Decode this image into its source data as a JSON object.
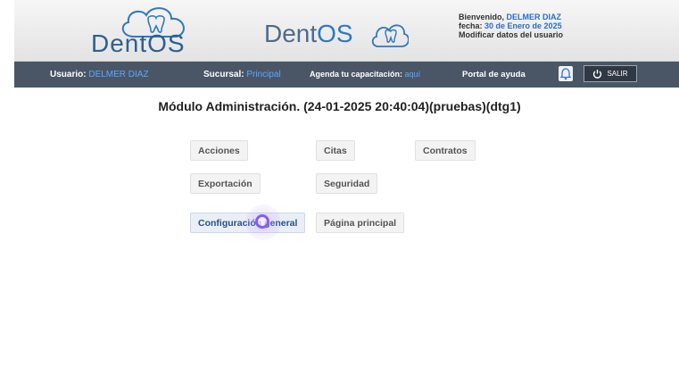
{
  "header": {
    "logo_text": "DentOS",
    "logo_center_part1": "Dent",
    "logo_center_part2": "OS",
    "welcome_prefix": "Bienvenido,",
    "welcome_user": "DELMER DIAZ",
    "date_prefix": "fecha:",
    "date_value": "30 de Enero de 2025",
    "modify_link": "Modificar datos del usuario"
  },
  "navbar": {
    "user_label": "Usuario:",
    "user_value": "DELMER DIAZ",
    "branch_label": "Sucursal:",
    "branch_value": "Principal",
    "training_label": "Agenda tu capacitación:",
    "training_link": "aquí",
    "help_label": "Portal de ayuda",
    "logout_label": "SALIR"
  },
  "main": {
    "title": "Módulo Administración. (24-01-2025 20:40:04)(pruebas)(dtg1)",
    "buttons": [
      "Acciones",
      "Citas",
      "Contratos",
      "Exportación",
      "Seguridad",
      "Configuración general",
      "Página principal"
    ]
  },
  "icons": {
    "bell": "bell-icon",
    "power": "power-icon",
    "tooth": "tooth-cloud-icon"
  },
  "colors": {
    "navbar": "#4a5666",
    "accent": "#2a6fc9",
    "link": "#5aa8ff"
  }
}
